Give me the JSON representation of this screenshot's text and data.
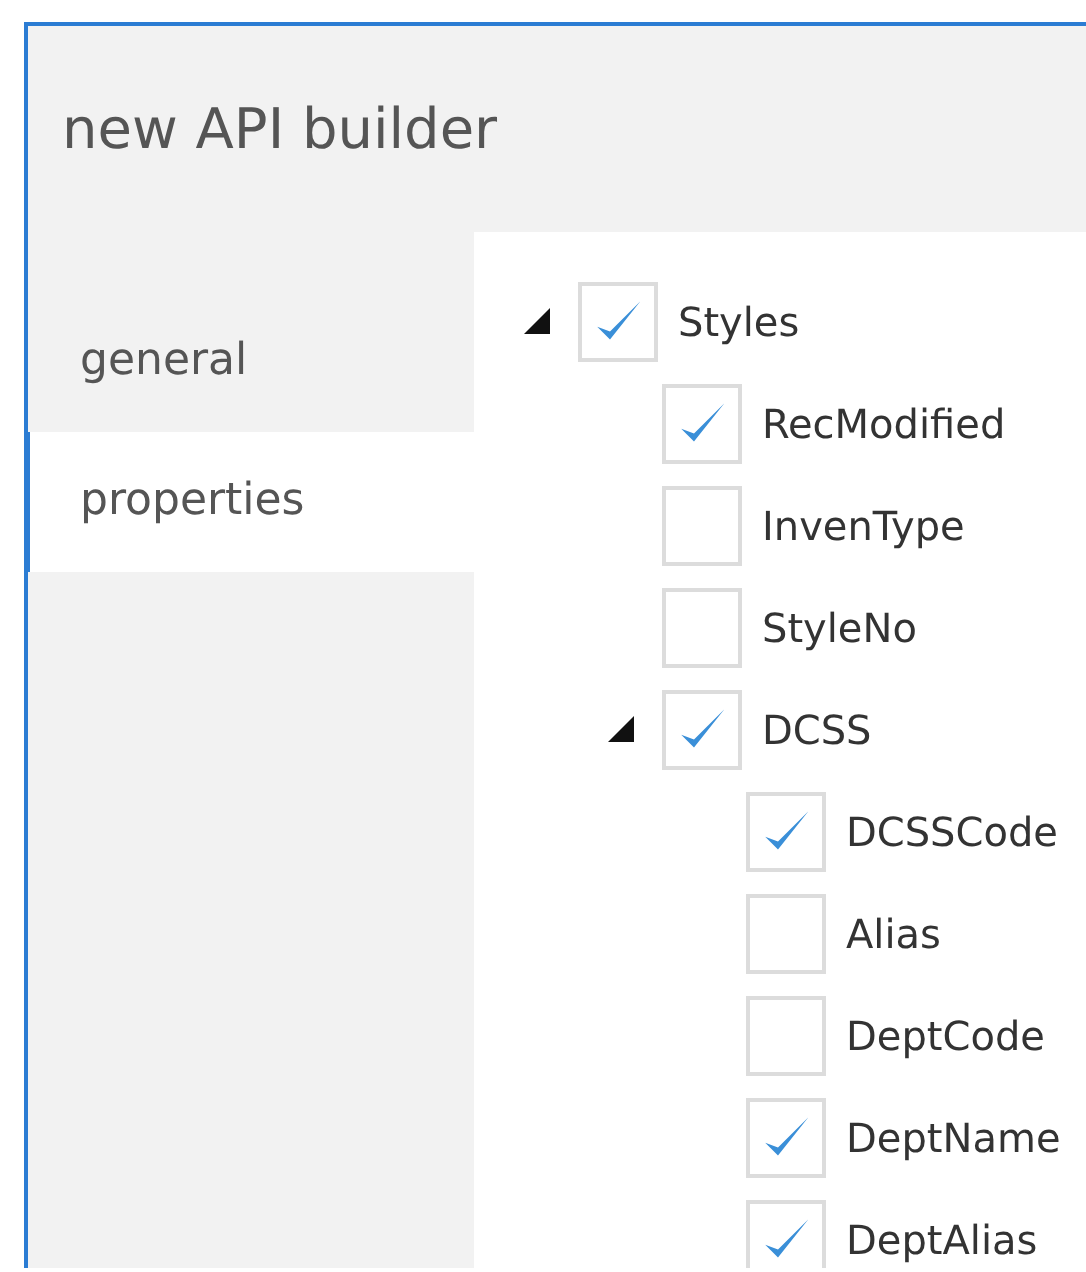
{
  "window": {
    "title": "new API builder"
  },
  "sidebar": {
    "items": [
      {
        "label": "general",
        "selected": false
      },
      {
        "label": "properties",
        "selected": true
      }
    ]
  },
  "tree": [
    {
      "label": "Styles",
      "checked": true,
      "expanded": true,
      "children": [
        {
          "label": "RecModified",
          "checked": true
        },
        {
          "label": "InvenType",
          "checked": false
        },
        {
          "label": "StyleNo",
          "checked": false
        },
        {
          "label": "DCSS",
          "checked": true,
          "expanded": true,
          "children": [
            {
              "label": "DCSSCode",
              "checked": true
            },
            {
              "label": "Alias",
              "checked": false
            },
            {
              "label": "DeptCode",
              "checked": false
            },
            {
              "label": "DeptName",
              "checked": true
            },
            {
              "label": "DeptAlias",
              "checked": true
            }
          ]
        }
      ]
    }
  ]
}
